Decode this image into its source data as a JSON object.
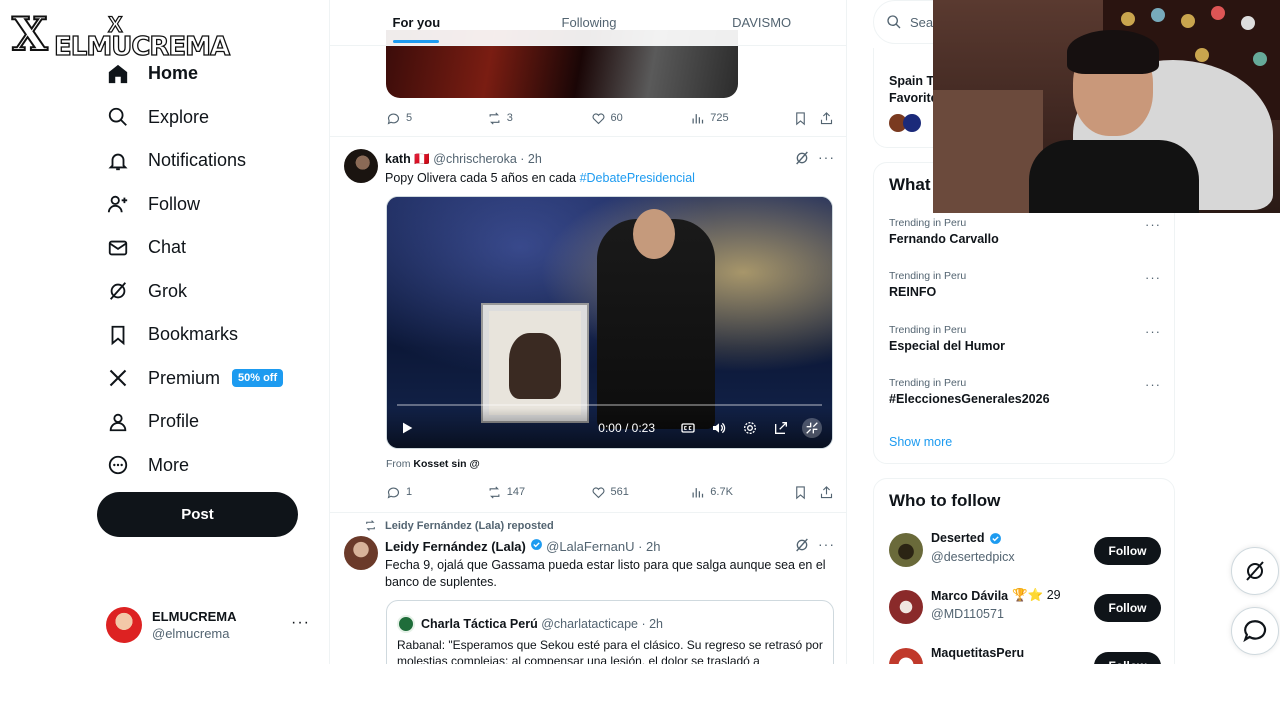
{
  "overlay": {
    "brand": "ELMUCREMA",
    "mark": "X"
  },
  "nav": {
    "items": [
      {
        "label": "Home",
        "icon": "home-icon",
        "active": true
      },
      {
        "label": "Explore",
        "icon": "search-icon"
      },
      {
        "label": "Notifications",
        "icon": "bell-icon"
      },
      {
        "label": "Follow",
        "icon": "add-person-icon"
      },
      {
        "label": "Chat",
        "icon": "envelope-icon"
      },
      {
        "label": "Grok",
        "icon": "grok-icon"
      },
      {
        "label": "Bookmarks",
        "icon": "bookmark-icon"
      },
      {
        "label": "Premium",
        "icon": "x-logo-icon",
        "badge": "50% off"
      },
      {
        "label": "Profile",
        "icon": "person-icon"
      },
      {
        "label": "More",
        "icon": "more-circle-icon"
      }
    ],
    "post_label": "Post"
  },
  "account": {
    "name": "ELMUCREMA",
    "handle": "@elmucrema"
  },
  "tabs": [
    {
      "label": "For you",
      "active": true
    },
    {
      "label": "Following"
    },
    {
      "label": "DAVISMO"
    }
  ],
  "top_tweet_actions": {
    "replies": "5",
    "reposts": "3",
    "likes": "60",
    "views": "725"
  },
  "tweet1": {
    "name": "kath",
    "flag": "🇵🇪",
    "handle": "@chrischeroka",
    "time": "· 2h",
    "text": "Popy Olivera cada 5 años en cada ",
    "hashtag": "#DebatePresidencial",
    "video_time": "0:00 / 0:23",
    "from_prefix": "From ",
    "from_source": "Kosset sin @",
    "replies": "1",
    "reposts": "147",
    "likes": "561",
    "views": "6.7K"
  },
  "tweet2": {
    "repost_by": "Leidy Fernández (Lala) reposted",
    "name": "Leidy Fernández (Lala)",
    "handle": "@LalaFernanU",
    "time": "· 2h",
    "text": "Fecha 9, ojalá que Gassama pueda estar listo para que salga aunque sea en el banco de suplentes.",
    "quote": {
      "name": "Charla Táctica Perú",
      "handle": "@charlatacticape",
      "time": "· 2h",
      "text": "Rabanal: \"Esperamos que Sekou esté para el clásico. Su regreso se retrasó por molestias complejas: al compensar una lesión, el dolor se trasladó a"
    }
  },
  "right": {
    "search_placeholder": "Search",
    "top_card": {
      "title": "Spain T",
      "subtitle": "Favorite"
    },
    "trending_title": "What",
    "trends": [
      {
        "context": "Trending in Peru",
        "title": "Fernando Carvallo"
      },
      {
        "context": "Trending in Peru",
        "title": "REINFO"
      },
      {
        "context": "Trending in Peru",
        "title": "Especial del Humor"
      },
      {
        "context": "Trending in Peru",
        "title": "#EleccionesGenerales2026"
      }
    ],
    "show_more": "Show more",
    "who_to_follow_title": "Who to follow",
    "follow_suggestions": [
      {
        "name": "Deserted",
        "handle": "@desertedpicx",
        "verified": true,
        "button": "Follow",
        "extra": ""
      },
      {
        "name": "Marco Dávila",
        "handle": "@MD110571",
        "verified": false,
        "button": "Follow",
        "extra": "🏆⭐ 29"
      },
      {
        "name": "MaquetitasPeru",
        "handle": "",
        "verified": false,
        "button": "Follow",
        "extra": ""
      }
    ]
  },
  "colors": {
    "accent": "#1d9bf0",
    "text": "#0f1419",
    "muted": "#536471"
  }
}
